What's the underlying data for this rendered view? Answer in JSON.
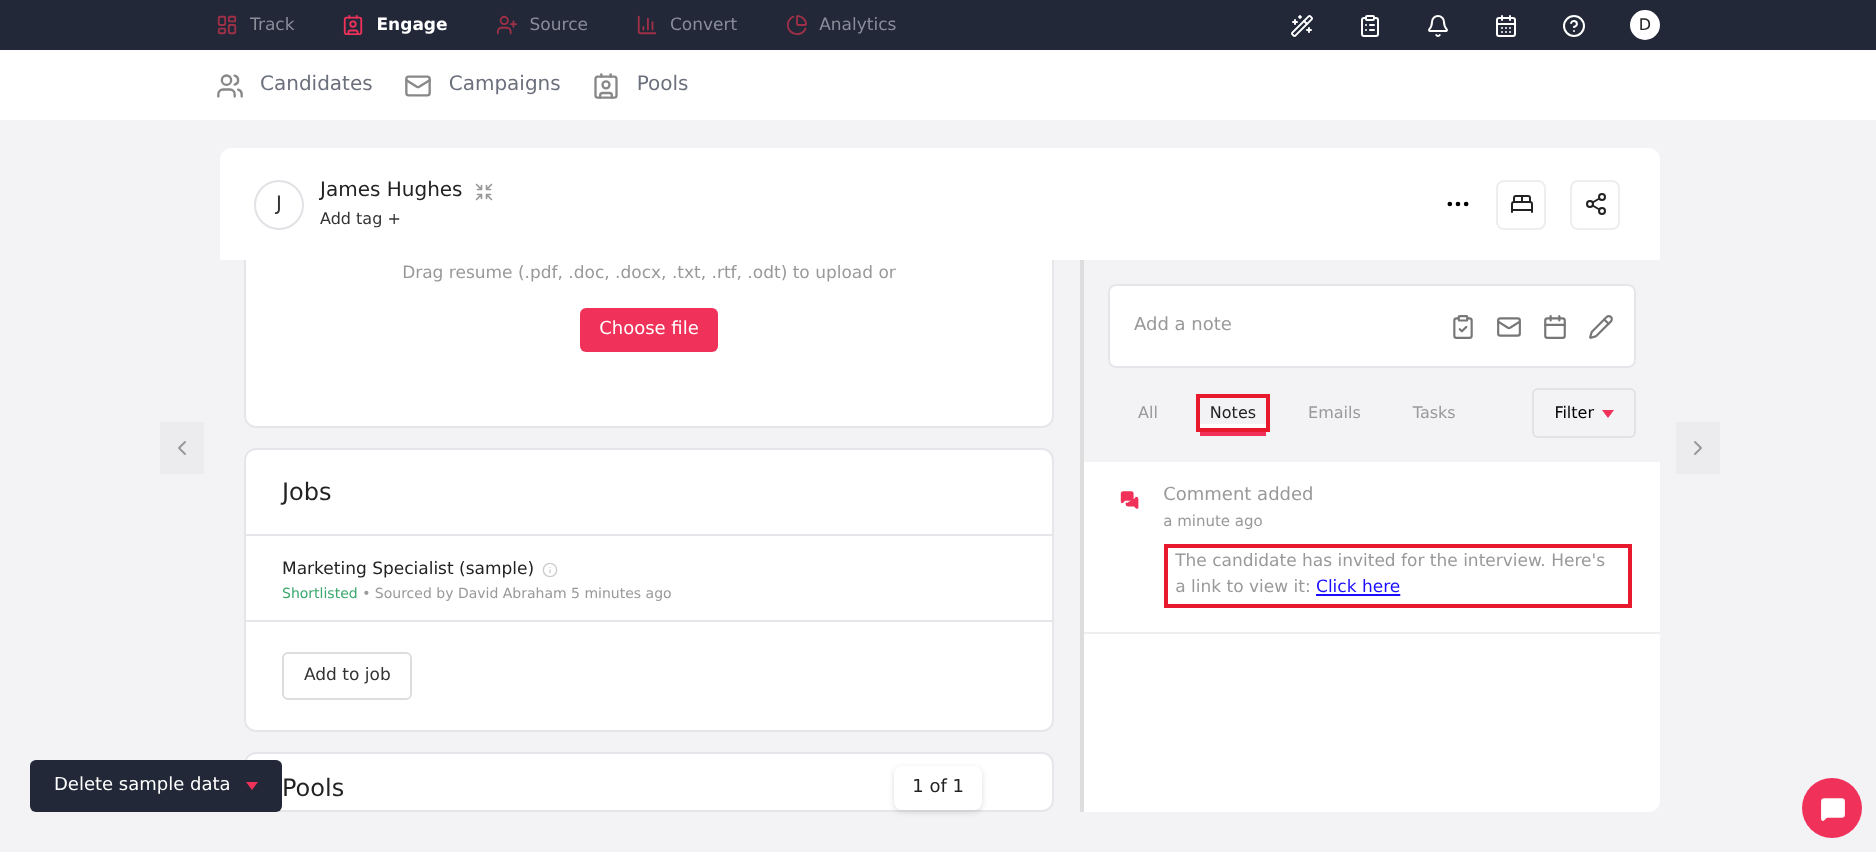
{
  "top_nav": {
    "items": [
      {
        "label": "Track",
        "selected": false
      },
      {
        "label": "Engage",
        "selected": true
      },
      {
        "label": "Source",
        "selected": false
      },
      {
        "label": "Convert",
        "selected": false
      },
      {
        "label": "Analytics",
        "selected": false
      }
    ],
    "avatar": "D"
  },
  "sub_nav": {
    "items": [
      {
        "label": "Candidates"
      },
      {
        "label": "Campaigns"
      },
      {
        "label": "Pools"
      }
    ]
  },
  "candidate": {
    "initial": "J",
    "name": "James Hughes",
    "add_tag": "Add tag +"
  },
  "upload": {
    "hint": "Drag resume (.pdf, .doc, .docx, .txt, .rtf, .odt) to upload or",
    "button": "Choose file"
  },
  "jobs": {
    "title": "Jobs",
    "items": [
      {
        "title": "Marketing Specialist (sample)",
        "status": "Shortlisted",
        "meta": "• Sourced by David Abraham 5 minutes ago"
      }
    ],
    "button": "Add to job"
  },
  "pools": {
    "title": "Pools",
    "pager": "1 of 1"
  },
  "notes": {
    "placeholder": "Add a note",
    "tabs": [
      {
        "label": "All",
        "selected": false,
        "highlighted": false
      },
      {
        "label": "Notes",
        "selected": true,
        "highlighted": true
      },
      {
        "label": "Emails",
        "selected": false,
        "highlighted": false
      },
      {
        "label": "Tasks",
        "selected": false,
        "highlighted": false
      }
    ],
    "filter": "Filter",
    "feed": [
      {
        "title": "Comment added",
        "time": "a minute ago",
        "text": "The candidate has invited for the interview. Here's a link to view it:",
        "link": "Click here",
        "highlighted": true
      }
    ]
  },
  "delete_button": "Delete sample data"
}
